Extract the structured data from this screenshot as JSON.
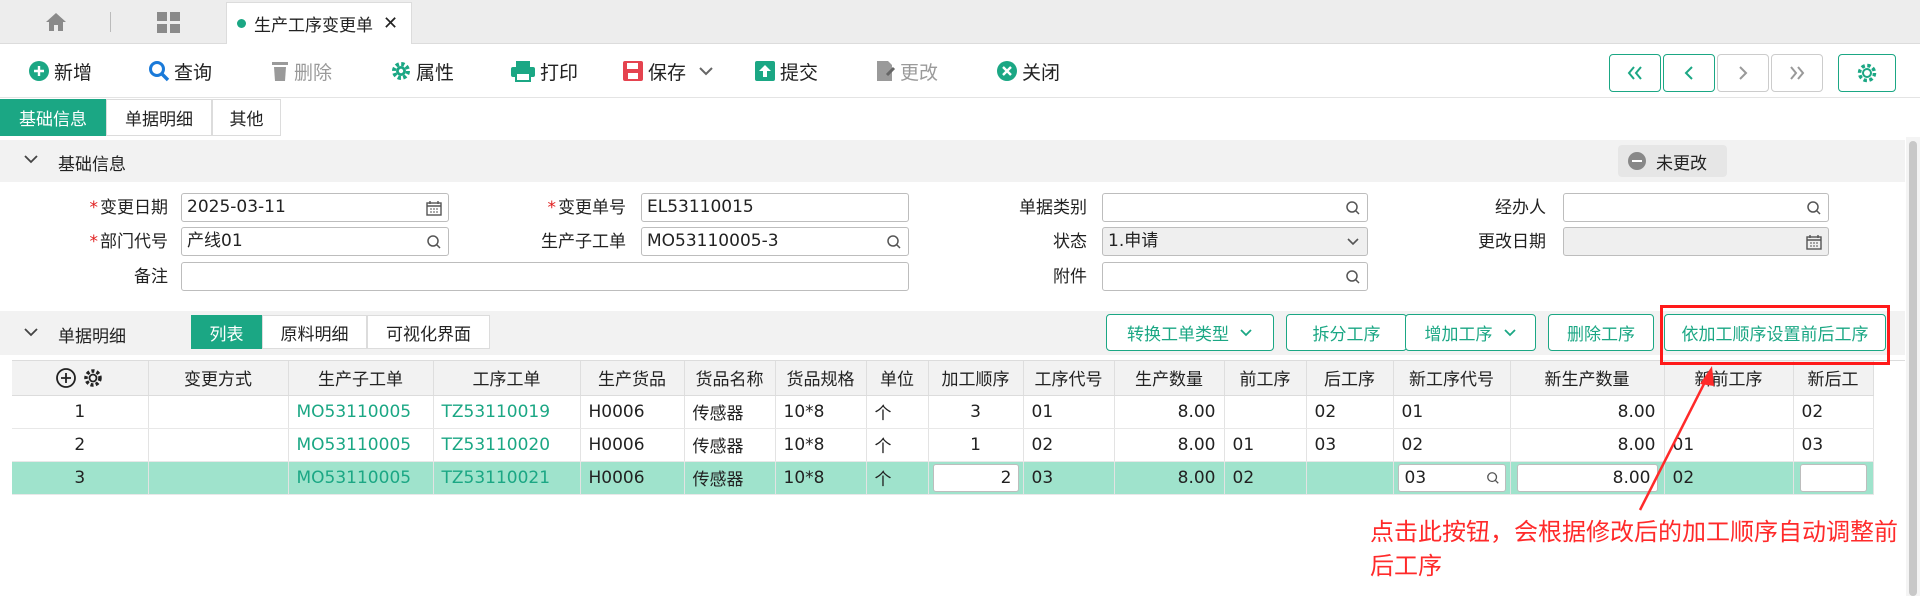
{
  "tabs": {
    "active_doc_tab": "生产工序变更单"
  },
  "toolbar": {
    "new": "新增",
    "query": "查询",
    "delete": "删除",
    "properties": "属性",
    "print": "打印",
    "save": "保存",
    "submit": "提交",
    "change": "更改",
    "close": "关闭"
  },
  "section_tabs": [
    "基础信息",
    "单据明细",
    "其他"
  ],
  "basic": {
    "group_title": "基础信息",
    "status_badge": "未更改",
    "change_date_label": "变更日期",
    "change_date": "2025-03-11",
    "change_no_label": "变更单号",
    "change_no": "EL53110015",
    "doc_type_label": "单据类别",
    "doc_type": "",
    "handler_label": "经办人",
    "handler": "",
    "dept_label": "部门代号",
    "dept": "产线01",
    "sub_order_label": "生产子工单",
    "sub_order": "MO53110005-3",
    "state_label": "状态",
    "state": "1.申请",
    "modify_date_label": "更改日期",
    "modify_date": "",
    "remark_label": "备注",
    "remark": "",
    "attachment_label": "附件",
    "attachment": ""
  },
  "detail": {
    "group_title": "单据明细",
    "view_tabs": [
      "列表",
      "原料明细",
      "可视化界面"
    ],
    "actions": {
      "convert": "转换工单类型",
      "split": "拆分工序",
      "add": "增加工序",
      "remove": "删除工序",
      "set_order": "依加工顺序设置前后工序"
    },
    "columns": [
      "变更方式",
      "生产子工单",
      "工序工单",
      "生产货品",
      "货品名称",
      "货品规格",
      "单位",
      "加工顺序",
      "工序代号",
      "生产数量",
      "前工序",
      "后工序",
      "新工序代号",
      "新生产数量",
      "新前工序",
      "新后工"
    ],
    "rows": [
      {
        "no": "1",
        "method": "",
        "sub_order": "MO53110005",
        "op_order": "TZ53110019",
        "product": "H0006",
        "name": "传感器",
        "spec": "10*8",
        "unit": "个",
        "seq": "3",
        "op_code": "01",
        "qty": "8.00",
        "prev": "",
        "next": "02",
        "new_op": "01",
        "new_qty": "8.00",
        "new_prev": "",
        "new_next": "02"
      },
      {
        "no": "2",
        "method": "",
        "sub_order": "MO53110005",
        "op_order": "TZ53110020",
        "product": "H0006",
        "name": "传感器",
        "spec": "10*8",
        "unit": "个",
        "seq": "1",
        "op_code": "02",
        "qty": "8.00",
        "prev": "01",
        "next": "03",
        "new_op": "02",
        "new_qty": "8.00",
        "new_prev": "01",
        "new_next": "03"
      },
      {
        "no": "3",
        "method": "",
        "sub_order": "MO53110005",
        "op_order": "TZ53110021",
        "product": "H0006",
        "name": "传感器",
        "spec": "10*8",
        "unit": "个",
        "seq": "2",
        "op_code": "03",
        "qty": "8.00",
        "prev": "02",
        "next": "",
        "new_op": "03",
        "new_qty": "8.00",
        "new_prev": "02",
        "new_next": ""
      }
    ]
  },
  "annotation": {
    "text": "点击此按钮，会根据修改后的加工顺序自动调整前后工序"
  },
  "colors": {
    "accent": "#1ba784",
    "selected_row": "#9fe3cc",
    "annotation": "#ff2a2a"
  }
}
